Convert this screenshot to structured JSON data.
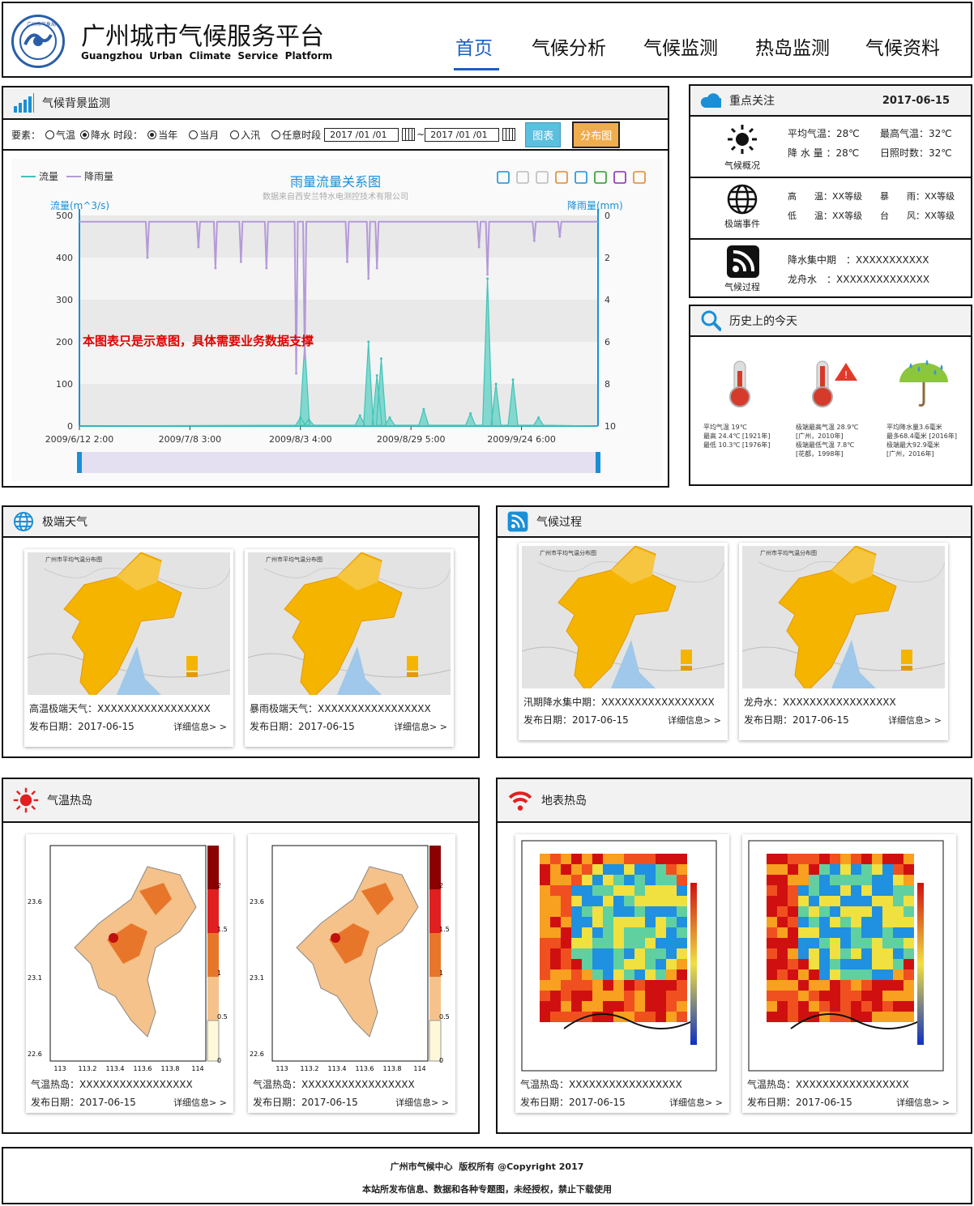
{
  "header": {
    "title_cn": "广州城市气候服务平台",
    "title_en": "Guangzhou  Urban  Climate  Service  Platform",
    "logo_text": "广州市气象局",
    "nav": [
      "首页",
      "气候分析",
      "气候监测",
      "热岛监测",
      "气候资料"
    ],
    "active_nav": "首页"
  },
  "background_panel": {
    "title": "气候背景监测",
    "filter": {
      "element_label": "要素：",
      "elements": [
        "气温",
        "降水"
      ],
      "element_selected": "降水",
      "period_label": "时段：",
      "periods": [
        "当年",
        "当月",
        "入汛",
        "任意时段"
      ],
      "period_selected": "当年",
      "date_from": "2017 /01 /01",
      "tilde": "~",
      "date_to": "2017 /01 /01",
      "btn_chart": "图表",
      "btn_dist": "分布图"
    }
  },
  "chart_data": {
    "type": "area",
    "title": "雨量流量关系图",
    "subtitle": "数据来自西安兰特水电测控技术有限公司",
    "legend": [
      "流量",
      "降雨量"
    ],
    "y_left_label": "流量(m^3/s)",
    "y_right_label": "降雨量(mm)",
    "y_left_ticks": [
      0,
      100,
      200,
      300,
      400,
      500
    ],
    "y_right_ticks": [
      0,
      2,
      4,
      6,
      8,
      10
    ],
    "ylim_left": [
      0,
      500
    ],
    "ylim_right": [
      10,
      0
    ],
    "x_ticks": [
      "2009/6/12 2:00",
      "2009/7/8 3:00",
      "2009/8/3 4:00",
      "2009/8/29 5:00",
      "2009/9/24 6:00"
    ],
    "grid": true,
    "legend_position": "top-left",
    "flow_peaks": [
      {
        "x": "2009/8/3",
        "y": 20
      },
      {
        "x": "2009/8/4",
        "y": 198
      },
      {
        "x": "2009/8/5",
        "y": 15
      },
      {
        "x": "2009/8/17",
        "y": 25
      },
      {
        "x": "2009/8/19",
        "y": 200
      },
      {
        "x": "2009/8/21",
        "y": 120
      },
      {
        "x": "2009/8/22",
        "y": 160
      },
      {
        "x": "2009/8/24",
        "y": 20
      },
      {
        "x": "2009/9/1",
        "y": 40
      },
      {
        "x": "2009/9/12",
        "y": 30
      },
      {
        "x": "2009/9/16",
        "y": 350
      },
      {
        "x": "2009/9/18",
        "y": 100
      },
      {
        "x": "2009/9/22",
        "y": 110
      },
      {
        "x": "2009/9/28",
        "y": 20
      }
    ],
    "rain_peaks": [
      {
        "x": "2009/6/28",
        "y": 2.0
      },
      {
        "x": "2009/7/10",
        "y": 1.5
      },
      {
        "x": "2009/7/14",
        "y": 2.5
      },
      {
        "x": "2009/7/20",
        "y": 2.2
      },
      {
        "x": "2009/7/26",
        "y": 2.5
      },
      {
        "x": "2009/8/2",
        "y": 7.5
      },
      {
        "x": "2009/8/4",
        "y": 6.8
      },
      {
        "x": "2009/8/14",
        "y": 2.2
      },
      {
        "x": "2009/8/19",
        "y": 3.0
      },
      {
        "x": "2009/8/21",
        "y": 2.5
      },
      {
        "x": "2009/9/14",
        "y": 1.5
      },
      {
        "x": "2009/9/16",
        "y": 2.8
      },
      {
        "x": "2009/9/27",
        "y": 1.2
      },
      {
        "x": "2009/10/3",
        "y": 1.0
      }
    ],
    "notice": "本图表只是示意图，具体需要业务数据支撑"
  },
  "focus": {
    "title": "重点关注",
    "date": "2017-06-15",
    "rows": [
      {
        "label": "气候概况",
        "icon": "sun-icon",
        "items": [
          "平均气温：28℃",
          "最高气温：32℃",
          "降 水 量 ：28℃",
          "日照时数：32℃"
        ]
      },
      {
        "label": "极端事件",
        "icon": "globe-icon",
        "items": [
          "高　　温：XX等级",
          "暴　　雨：XX等级",
          "低　　温：XX等级",
          "台　　风：XX等级"
        ]
      },
      {
        "label": "气候过程",
        "icon": "rss-icon",
        "items": [
          "降水集中期　：XXXXXXXXXXX",
          "龙舟水　：XXXXXXXXXXXXXX"
        ]
      }
    ]
  },
  "history": {
    "title": "历史上的今天",
    "items": [
      {
        "icon": "thermometer-icon",
        "lines": [
          "平均气温 19℃",
          "最高 24.4℃ [1921年]",
          "最低 10.3℃ [1976年]"
        ]
      },
      {
        "icon": "thermometer-alert-icon",
        "lines": [
          "极端最高气温 28.9℃",
          "[广州，2010年]",
          "极端最低气温 7.8℃",
          "[花都，1998年]"
        ]
      },
      {
        "icon": "umbrella-rain-icon",
        "lines": [
          "平均降水量3.6毫米",
          "最多68.4毫米 [2016年]",
          "极端最大92.9毫米",
          "[广州，2016年]"
        ]
      }
    ]
  },
  "extreme": {
    "title": "极端天气",
    "cards": [
      {
        "map_title": "广州市平均气温分布图",
        "name": "高温极端天气：XXXXXXXXXXXXXXXXX",
        "date": "发布日期：2017-06-15",
        "more": "详细信息> >"
      },
      {
        "map_title": "广州市平均气温分布图",
        "name": "暴雨极端天气：XXXXXXXXXXXXXXXXX",
        "date": "发布日期：2017-06-15",
        "more": "详细信息> >"
      }
    ]
  },
  "process": {
    "title": "气候过程",
    "cards": [
      {
        "map_title": "广州市平均气温分布图",
        "name": "汛期降水集中期：XXXXXXXXXXXXXXXXX",
        "date": "发布日期：2017-06-15",
        "more": "详细信息> >"
      },
      {
        "map_title": "广州市平均气温分布图",
        "name": "龙舟水：XXXXXXXXXXXXXXXXX",
        "date": "发布日期：2017-06-15",
        "more": "详细信息> >"
      }
    ]
  },
  "air_heat": {
    "title": "气温热岛",
    "x_ticks": [
      "113",
      "113.2",
      "113.4",
      "113.6",
      "113.8",
      "114"
    ],
    "y_ticks": [
      "23.6",
      "23.1",
      "22.6"
    ],
    "scale_ticks": [
      "2",
      "1.5",
      "1",
      "0.5",
      "0"
    ],
    "cards": [
      {
        "name": "气温热岛：XXXXXXXXXXXXXXXXX",
        "date": "发布日期：2017-06-15",
        "more": "详细信息> >"
      },
      {
        "name": "气温热岛：XXXXXXXXXXXXXXXXX",
        "date": "发布日期：2017-06-15",
        "more": "详细信息> >"
      }
    ]
  },
  "surface_heat": {
    "title": "地表热岛",
    "cards": [
      {
        "name": "气温热岛：XXXXXXXXXXXXXXXXX",
        "date": "发布日期：2017-06-15",
        "more": "详细信息> >"
      },
      {
        "name": "气温热岛：XXXXXXXXXXXXXXXXX",
        "date": "发布日期：2017-06-15",
        "more": "详细信息> >"
      }
    ]
  },
  "footer": {
    "line1": "广州市气候中心  版权所有 @Copyright 2017",
    "line2": "本站所发布信息、数据和各种专题图，未经授权，禁止下载使用"
  },
  "colors": {
    "accent": "#1a8fd6",
    "flow": "#40c4b8",
    "rain": "#b49ad8",
    "notice": "#e00000",
    "btn_chart": "#5bc0de",
    "btn_dist": "#f0ad4e"
  }
}
